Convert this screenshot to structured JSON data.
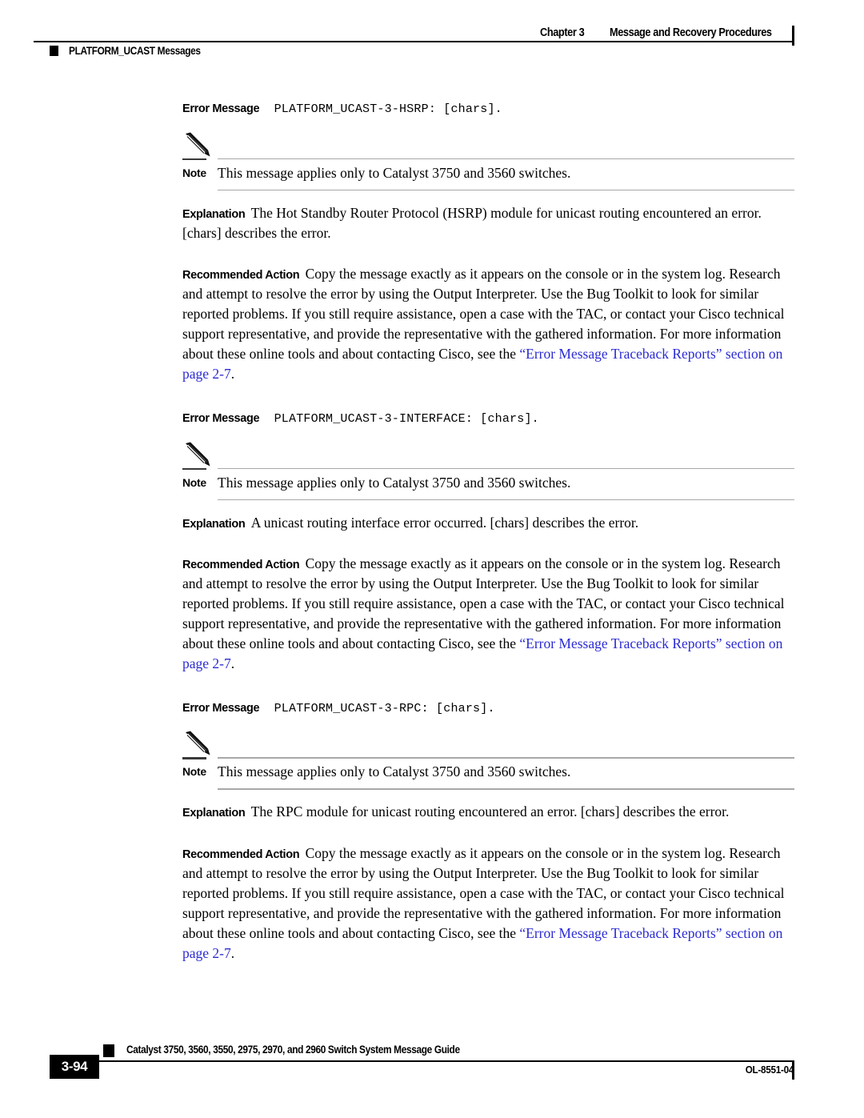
{
  "header": {
    "chapter": "Chapter 3",
    "chapter_title": "Message and Recovery Procedures",
    "section": "PLATFORM_UCAST Messages"
  },
  "labels": {
    "error_message": "Error Message",
    "note": "Note",
    "explanation": "Explanation",
    "recommended_action": "Recommended Action"
  },
  "common": {
    "note_text": "This message applies only to Catalyst 3750 and 3560 switches.",
    "action_text_before_link": "Copy the message exactly as it appears on the console or in the system log. Research and attempt to resolve the error by using the Output Interpreter. Use the Bug Toolkit to look for similar reported problems. If you still require assistance, open a case with the TAC, or contact your Cisco technical support representative, and provide the representative with the gathered information. For more information about these online tools and about contacting Cisco, see the ",
    "action_link_text": "“Error Message Traceback Reports” section on page 2-7",
    "action_text_after_link": ".",
    "link_color": "#2b2bd4"
  },
  "messages": [
    {
      "id": "PLATFORM_UCAST-3-HSRP: [chars].",
      "explanation": "The Hot Standby Router Protocol (HSRP) module for unicast routing encountered an error. [chars] describes the error."
    },
    {
      "id": "PLATFORM_UCAST-3-INTERFACE: [chars].",
      "explanation": "A unicast routing interface error occurred. [chars] describes the error."
    },
    {
      "id": "PLATFORM_UCAST-3-RPC: [chars].",
      "explanation": "The RPC module for unicast routing encountered an error. [chars] describes the error."
    }
  ],
  "footer": {
    "page_number": "3-94",
    "guide_title": "Catalyst 3750, 3560, 3550, 2975, 2970, and 2960 Switch System Message Guide",
    "document_id": "OL-8551-04"
  }
}
